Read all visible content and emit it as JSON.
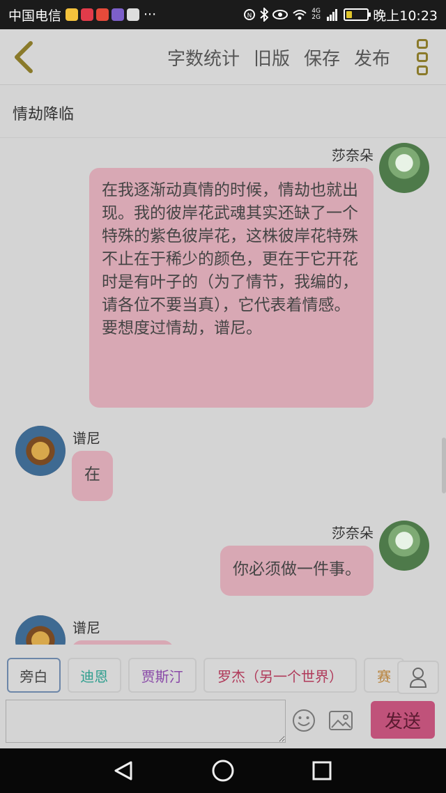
{
  "status_bar": {
    "carrier": "中国电信",
    "ellipsis": "···",
    "net_speed": "4G 2G",
    "time": "晚上10:23",
    "battery_level": 0.3,
    "app_colors": [
      "#f4c23c",
      "#e23b4a",
      "#e54a3a",
      "#7c5fc9",
      "#dddddd"
    ]
  },
  "header": {
    "actions": [
      "字数统计",
      "旧版",
      "保存",
      "发布"
    ]
  },
  "story": {
    "title": "情劫降临"
  },
  "messages": [
    {
      "side": "right",
      "speaker": "莎奈朵",
      "text": "在我逐渐动真情的时候，情劫也就出现。我的彼岸花武魂其实还缺了一个特殊的紫色彼岸花，这株彼岸花特殊不止在于稀少的颜色，更在于它开花时是有叶子的（为了情节，我编的，请各位不要当真），它代表着情感。要想度过情劫，谱尼。"
    },
    {
      "side": "left",
      "speaker": "谱尼",
      "text": "在"
    },
    {
      "side": "right",
      "speaker": "莎奈朵",
      "text": "你必须做一件事。"
    },
    {
      "side": "left",
      "speaker": "谱尼",
      "text": ""
    }
  ],
  "roles": [
    {
      "label": "旁白",
      "color": "#444444"
    },
    {
      "label": "迪恩",
      "color": "#2e9e8e"
    },
    {
      "label": "贾斯汀",
      "color": "#8a4aa8"
    },
    {
      "label": "罗杰（另一个世界）",
      "color": "#b03a5a"
    },
    {
      "label": "赛",
      "color": "#b8823a"
    }
  ],
  "input": {
    "value": "",
    "placeholder": "",
    "send_label": "发送"
  }
}
